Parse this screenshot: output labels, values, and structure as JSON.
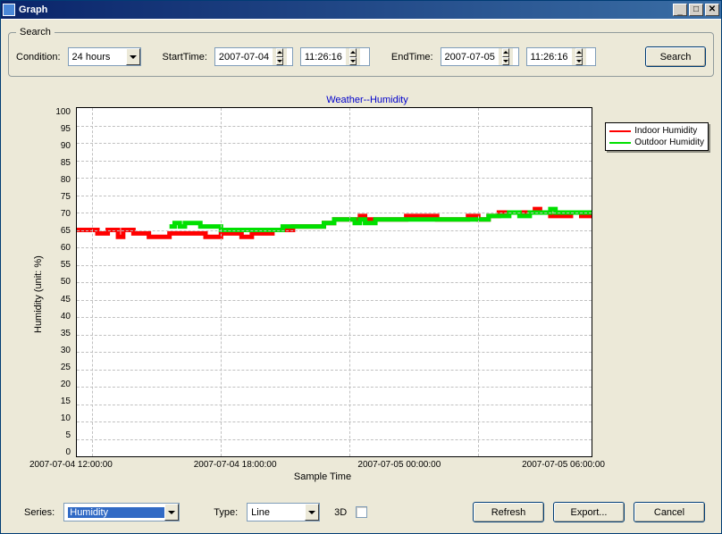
{
  "window": {
    "title": "Graph"
  },
  "search": {
    "legend": "Search",
    "condition_label": "Condition:",
    "condition_value": "24 hours",
    "start_label": "StartTime:",
    "start_date": "2007-07-04",
    "start_time": "11:26:16",
    "end_label": "EndTime:",
    "end_date": "2007-07-05",
    "end_time": "11:26:16",
    "search_btn": "Search"
  },
  "chart_data": {
    "type": "line",
    "title": "Weather--Humidity",
    "xlabel": "Sample Time",
    "ylabel": "Humidity (unit: %)",
    "ylim": [
      0,
      100
    ],
    "yticks": [
      100,
      95,
      90,
      85,
      80,
      75,
      70,
      65,
      60,
      55,
      50,
      45,
      40,
      35,
      30,
      25,
      20,
      15,
      10,
      5,
      0
    ],
    "xticks": [
      "2007-07-04 12:00:00",
      "2007-07-04 18:00:00",
      "2007-07-05 00:00:00",
      "2007-07-05 06:00:00"
    ],
    "series": [
      {
        "name": "Indoor Humidity",
        "color": "#ff0000",
        "points": [
          [
            0.0,
            65
          ],
          [
            0.02,
            65
          ],
          [
            0.04,
            64
          ],
          [
            0.06,
            65
          ],
          [
            0.08,
            63
          ],
          [
            0.09,
            65
          ],
          [
            0.11,
            64
          ],
          [
            0.12,
            64
          ],
          [
            0.14,
            63
          ],
          [
            0.16,
            63
          ],
          [
            0.18,
            64
          ],
          [
            0.2,
            64
          ],
          [
            0.22,
            64
          ],
          [
            0.24,
            64
          ],
          [
            0.25,
            63
          ],
          [
            0.28,
            64
          ],
          [
            0.3,
            64
          ],
          [
            0.32,
            63
          ],
          [
            0.34,
            64
          ],
          [
            0.36,
            64
          ],
          [
            0.38,
            65
          ],
          [
            0.4,
            65
          ],
          [
            0.42,
            66
          ],
          [
            0.44,
            66
          ],
          [
            0.46,
            66
          ],
          [
            0.48,
            67
          ],
          [
            0.5,
            68
          ],
          [
            0.52,
            68
          ],
          [
            0.54,
            68
          ],
          [
            0.55,
            69
          ],
          [
            0.56,
            68
          ],
          [
            0.58,
            68
          ],
          [
            0.6,
            68
          ],
          [
            0.62,
            68
          ],
          [
            0.64,
            69
          ],
          [
            0.66,
            69
          ],
          [
            0.68,
            69
          ],
          [
            0.7,
            68
          ],
          [
            0.72,
            68
          ],
          [
            0.74,
            68
          ],
          [
            0.76,
            69
          ],
          [
            0.78,
            68
          ],
          [
            0.8,
            69
          ],
          [
            0.82,
            70
          ],
          [
            0.84,
            70
          ],
          [
            0.86,
            70
          ],
          [
            0.88,
            70
          ],
          [
            0.89,
            71
          ],
          [
            0.9,
            70
          ],
          [
            0.92,
            69
          ],
          [
            0.94,
            69
          ],
          [
            0.96,
            70
          ],
          [
            0.98,
            69
          ],
          [
            1.0,
            69
          ]
        ]
      },
      {
        "name": "Outdoor Humidity",
        "color": "#00e000",
        "points": [
          [
            0.18,
            66
          ],
          [
            0.19,
            67
          ],
          [
            0.2,
            66
          ],
          [
            0.21,
            67
          ],
          [
            0.22,
            67
          ],
          [
            0.24,
            66
          ],
          [
            0.28,
            65
          ],
          [
            0.32,
            65
          ],
          [
            0.34,
            65
          ],
          [
            0.36,
            65
          ],
          [
            0.38,
            65
          ],
          [
            0.4,
            66
          ],
          [
            0.42,
            66
          ],
          [
            0.44,
            66
          ],
          [
            0.46,
            66
          ],
          [
            0.48,
            67
          ],
          [
            0.5,
            68
          ],
          [
            0.52,
            68
          ],
          [
            0.54,
            67
          ],
          [
            0.55,
            68
          ],
          [
            0.56,
            67
          ],
          [
            0.58,
            68
          ],
          [
            0.6,
            68
          ],
          [
            0.62,
            68
          ],
          [
            0.64,
            68
          ],
          [
            0.66,
            68
          ],
          [
            0.68,
            68
          ],
          [
            0.7,
            68
          ],
          [
            0.72,
            68
          ],
          [
            0.74,
            68
          ],
          [
            0.76,
            68
          ],
          [
            0.78,
            68
          ],
          [
            0.8,
            69
          ],
          [
            0.82,
            69
          ],
          [
            0.84,
            70
          ],
          [
            0.86,
            69
          ],
          [
            0.88,
            70
          ],
          [
            0.9,
            70
          ],
          [
            0.92,
            71
          ],
          [
            0.93,
            70
          ],
          [
            0.94,
            70
          ],
          [
            0.96,
            70
          ],
          [
            0.98,
            70
          ],
          [
            1.0,
            70
          ]
        ]
      }
    ]
  },
  "toolbar": {
    "series_label": "Series:",
    "series_value": "Humidity",
    "type_label": "Type:",
    "type_value": "Line",
    "threeD_label": "3D",
    "refresh": "Refresh",
    "export": "Export...",
    "cancel": "Cancel"
  }
}
